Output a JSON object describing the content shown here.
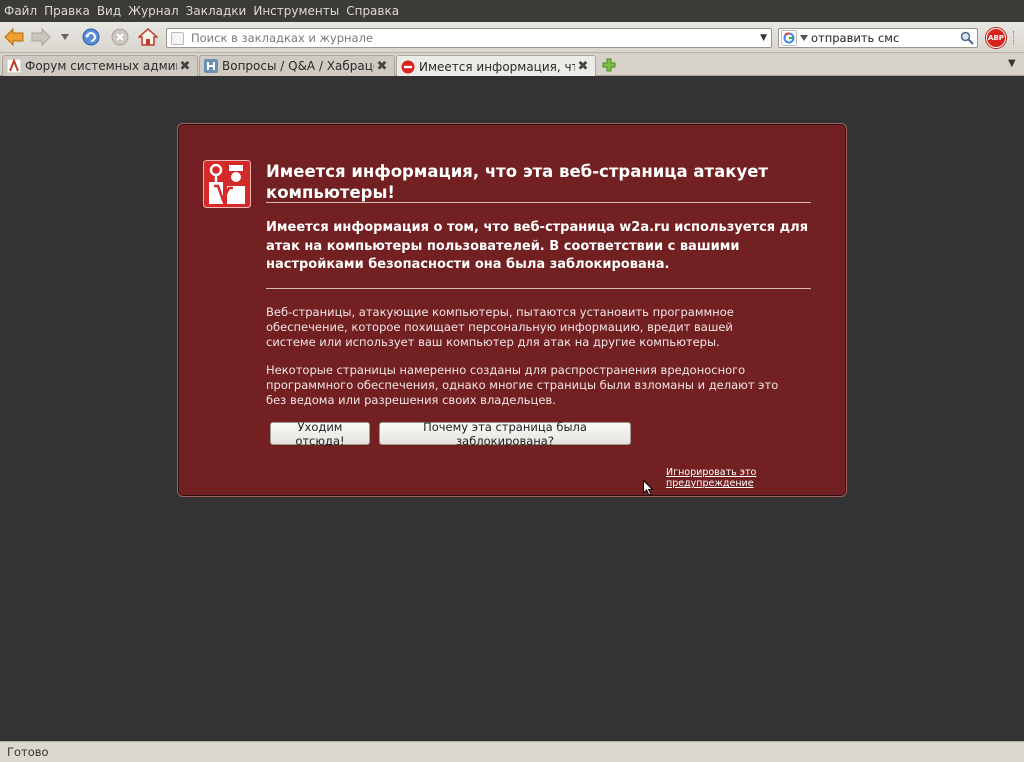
{
  "menubar": {
    "items": [
      {
        "label": "Файл"
      },
      {
        "label": "Правка"
      },
      {
        "label": "Вид"
      },
      {
        "label": "Журнал"
      },
      {
        "label": "Закладки"
      },
      {
        "label": "Инструменты"
      },
      {
        "label": "Справка"
      }
    ]
  },
  "navbar": {
    "back_icon": "back-arrow-icon",
    "forward_icon": "forward-arrow-icon",
    "reload_icon": "reload-icon",
    "stop_icon": "stop-icon",
    "home_icon": "home-icon",
    "url_placeholder": "Поиск в закладках и журнале",
    "search_engine_icon": "google-icon",
    "search_value": "отправить смс",
    "adblock_label": "ABP"
  },
  "tabs": [
    {
      "title": "Форум системных админ...",
      "icon": "forum-icon",
      "active": false
    },
    {
      "title": "Вопросы / Q&A / Хабраце...",
      "icon": "habr-icon",
      "active": false
    },
    {
      "title": "Имеется информация, чт...",
      "icon": "blocked-icon",
      "active": true
    }
  ],
  "error": {
    "title": "Имеется информация, что эта веб-страница атакует компьютеры!",
    "short_desc": "Имеется информация о том, что веб-страница w2a.ru используется для атак на компьютеры пользователей. В соответствии с вашими настройками безопасности она была заблокирована.",
    "long_desc_1": "Веб-страницы, атакующие компьютеры, пытаются установить программное обеспечение, которое похищает персональную информацию, вредит вашей системе или использует ваш компьютер для атак на другие компьютеры.",
    "long_desc_2": "Некоторые страницы намеренно созданы для распространения вредоносного программного обеспечения, однако многие страницы были взломаны и делают это без ведома или разрешения своих владельцев.",
    "get_out_button": "Уходим отсюда!",
    "why_button": "Почему эта страница была заблокирована?",
    "ignore_link": "Игнорировать это предупреждение",
    "box_color": "#722021"
  },
  "status": {
    "text": "Готово"
  }
}
